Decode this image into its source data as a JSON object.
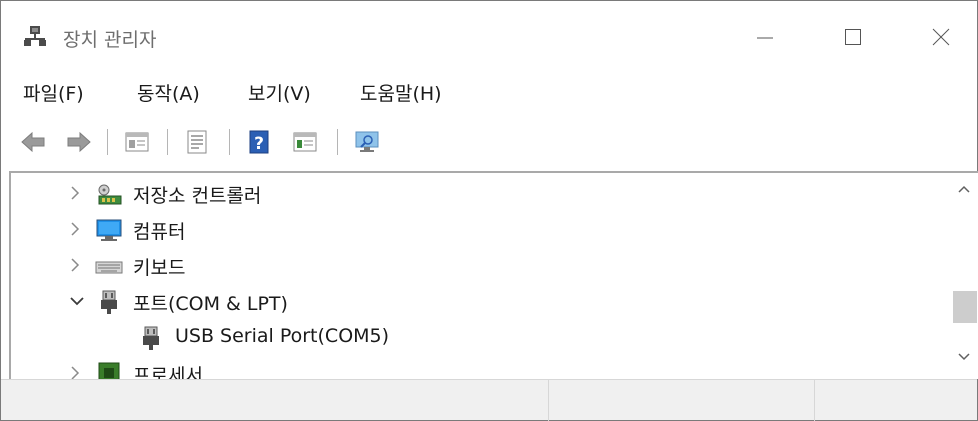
{
  "window": {
    "title": "장치 관리자",
    "controls": {
      "minimize": "minimize",
      "maximize": "maximize",
      "close": "close"
    }
  },
  "menu": {
    "items": [
      {
        "label": "파일(F)"
      },
      {
        "label": "동작(A)"
      },
      {
        "label": "보기(V)"
      },
      {
        "label": "도움말(H)"
      }
    ]
  },
  "toolbar": {
    "buttons": [
      {
        "icon": "back-arrow-icon"
      },
      {
        "icon": "forward-arrow-icon"
      },
      {
        "icon": "show-hide-tree-icon"
      },
      {
        "icon": "properties-icon"
      },
      {
        "icon": "help-icon"
      },
      {
        "icon": "update-driver-icon"
      },
      {
        "icon": "scan-hardware-icon"
      }
    ]
  },
  "tree": {
    "items": [
      {
        "label": "저장소 컨트롤러",
        "state": "collapsed",
        "icon": "storage-controller-icon"
      },
      {
        "label": "컴퓨터",
        "state": "collapsed",
        "icon": "computer-monitor-icon"
      },
      {
        "label": "키보드",
        "state": "collapsed",
        "icon": "keyboard-icon"
      },
      {
        "label": "포트(COM & LPT)",
        "state": "expanded",
        "icon": "port-plug-icon"
      },
      {
        "label": "USB Serial Port(COM5)",
        "state": "child",
        "icon": "port-plug-icon"
      },
      {
        "label": "프로세서",
        "state": "collapsed",
        "icon": "processor-chip-icon"
      }
    ]
  },
  "statusbar": {
    "panes": [
      "",
      "",
      ""
    ]
  },
  "colors": {
    "accent_blue": "#2b7cd3",
    "monitor_blue": "#1e90e8",
    "chip_green": "#3a7d2a"
  }
}
